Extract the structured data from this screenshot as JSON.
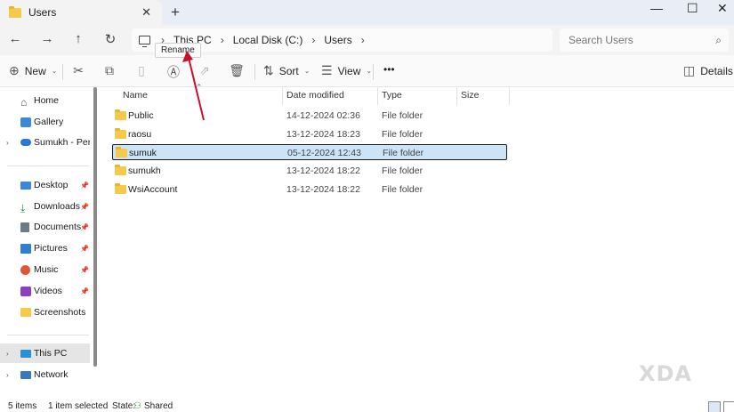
{
  "window": {
    "tab_title": "Users",
    "new_tab_symbol": "+",
    "close_symbol": "✕"
  },
  "address": {
    "breadcrumbs": [
      "This PC",
      "Local Disk (C:)",
      "Users"
    ],
    "search_placeholder": "Search Users"
  },
  "commands": {
    "new_label": "New",
    "sort_label": "Sort",
    "view_label": "View",
    "more_label": "•••",
    "details_label": "Details",
    "tooltip": "Rename"
  },
  "sidebar": {
    "items": [
      {
        "label": "Home",
        "icon": "home-icon"
      },
      {
        "label": "Gallery",
        "icon": "gallery-icon"
      },
      {
        "label": "Sumukh - Perso",
        "icon": "cloud-icon"
      },
      {
        "label": "Desktop",
        "icon": "desktop-icon"
      },
      {
        "label": "Downloads",
        "icon": "downloads-icon"
      },
      {
        "label": "Documents",
        "icon": "documents-icon"
      },
      {
        "label": "Pictures",
        "icon": "pictures-icon"
      },
      {
        "label": "Music",
        "icon": "music-icon"
      },
      {
        "label": "Videos",
        "icon": "videos-icon"
      },
      {
        "label": "Screenshots",
        "icon": "folder-icon"
      },
      {
        "label": "This PC",
        "icon": "pc-icon"
      },
      {
        "label": "Network",
        "icon": "network-icon"
      }
    ]
  },
  "columns": {
    "name": "Name",
    "date": "Date modified",
    "type": "Type",
    "size": "Size"
  },
  "files": [
    {
      "name": "Public",
      "date": "14-12-2024 02:36",
      "type": "File folder"
    },
    {
      "name": "raosu",
      "date": "13-12-2024 18:23",
      "type": "File folder"
    },
    {
      "name": "sumuk",
      "date": "05-12-2024 12:43",
      "type": "File folder"
    },
    {
      "name": "sumukh",
      "date": "13-12-2024 18:22",
      "type": "File folder"
    },
    {
      "name": "WsiAccount",
      "date": "13-12-2024 18:22",
      "type": "File folder"
    }
  ],
  "status": {
    "count": "5 items",
    "selected": "1 item selected",
    "state_label": "State:",
    "state_value": "Shared"
  },
  "watermark": "XDA",
  "colors": {
    "accent": "#c8102e",
    "folder": "#f7c948",
    "selection": "#cce4f7"
  }
}
